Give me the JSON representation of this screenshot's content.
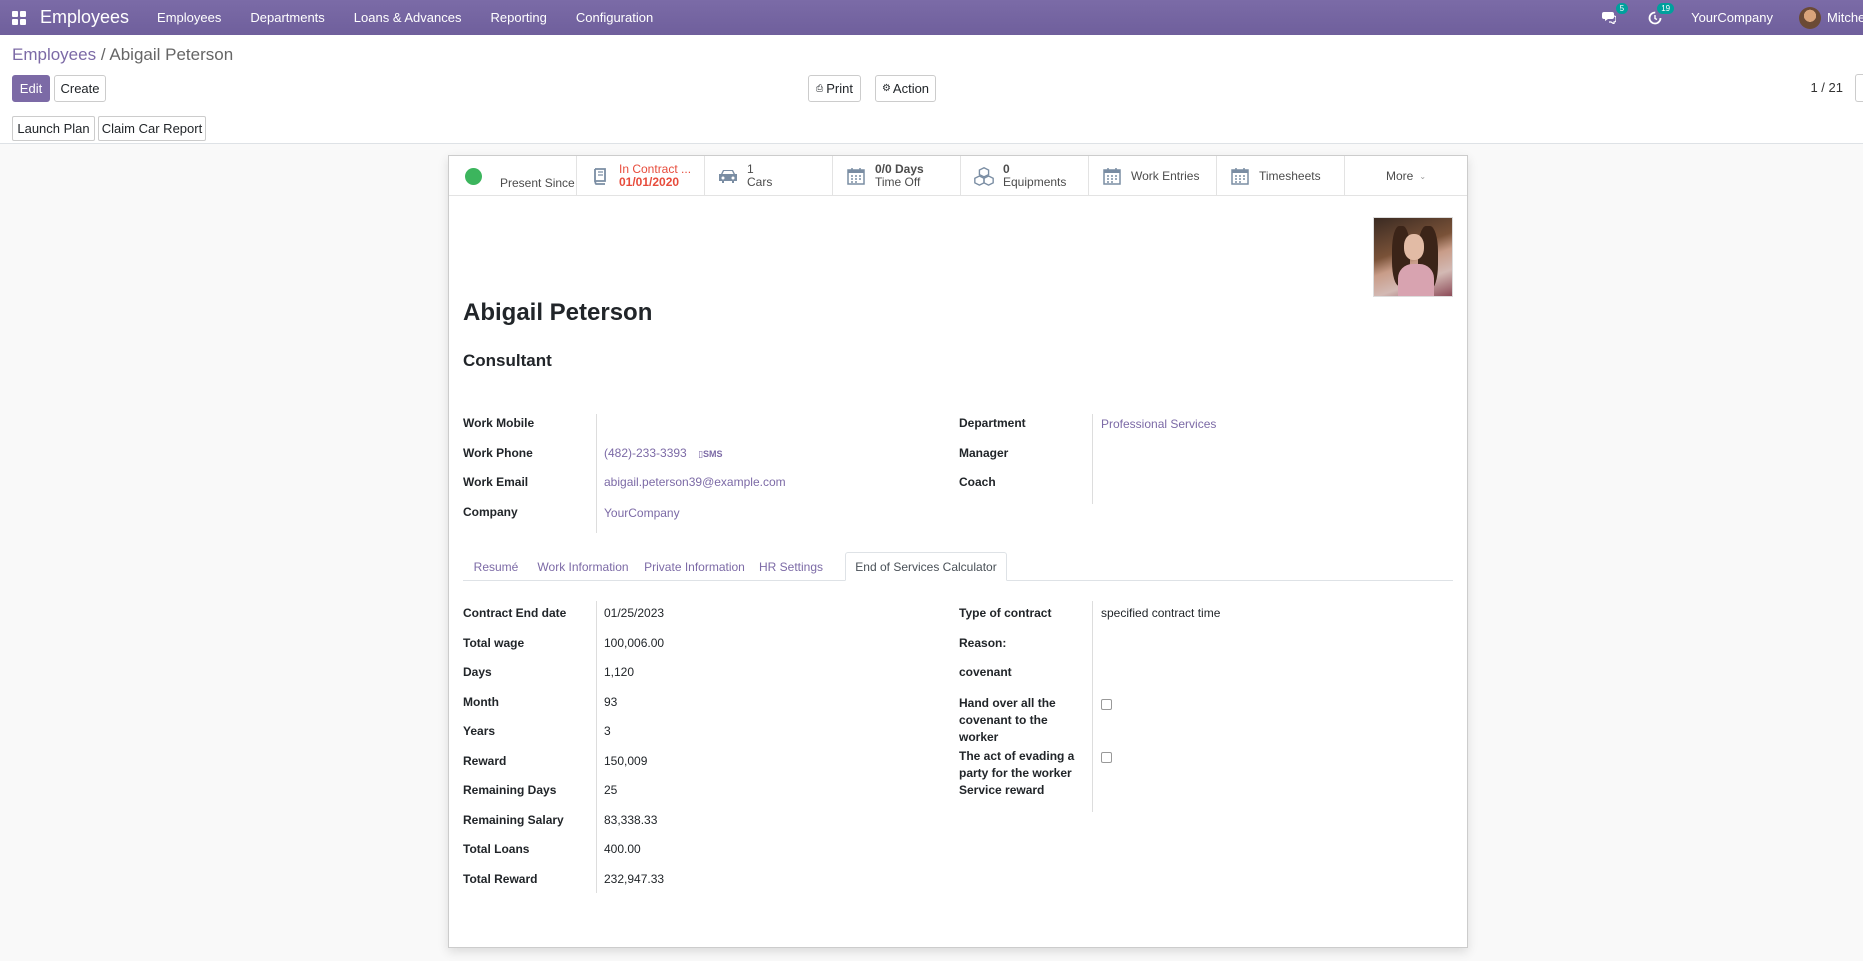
{
  "navbar": {
    "app_title": "Employees",
    "menu": [
      "Employees",
      "Departments",
      "Loans & Advances",
      "Reporting",
      "Configuration"
    ],
    "messages_count": "5",
    "activities_count": "19",
    "company": "YourCompany",
    "user": "Mitchell Admin"
  },
  "control_panel": {
    "breadcrumb_parent": "Employees",
    "breadcrumb_separator": "/",
    "breadcrumb_current": "Abigail Peterson",
    "edit_label": "Edit",
    "create_label": "Create",
    "print_label": "Print",
    "action_label": "Action",
    "pager": "1 / 21",
    "launch_plan_label": "Launch Plan",
    "claim_car_report_label": "Claim Car Report"
  },
  "smart_buttons": {
    "presence_label": "Present Since",
    "contract_value": "In Contract ...",
    "contract_label": "01/01/2020",
    "cars_value": "1",
    "cars_label": "Cars",
    "timeoff_value": "0/0 Days",
    "timeoff_label": "Time Off",
    "equipments_value": "0",
    "equipments_label": "Equipments",
    "work_entries_label": "Work Entries",
    "timesheets_label": "Timesheets",
    "more_label": "More"
  },
  "employee": {
    "name": "Abigail Peterson",
    "job_title": "Consultant"
  },
  "info_left": {
    "work_mobile_label": "Work Mobile",
    "work_mobile": "",
    "work_phone_label": "Work Phone",
    "work_phone": "(482)-233-3393",
    "sms_label": "SMS",
    "work_email_label": "Work Email",
    "work_email": "abigail.peterson39@example.com",
    "company_label": "Company",
    "company": "YourCompany"
  },
  "info_right": {
    "department_label": "Department",
    "department": "Professional Services",
    "manager_label": "Manager",
    "manager": "",
    "coach_label": "Coach",
    "coach": ""
  },
  "tabs": [
    "Resumé",
    "Work Information",
    "Private Information",
    "HR Settings",
    "End of Services Calculator"
  ],
  "active_tab": "End of Services Calculator",
  "eos_left": {
    "contract_end_label": "Contract End date",
    "contract_end": "01/25/2023",
    "total_wage_label": "Total wage",
    "total_wage": "100,006.00",
    "days_label": "Days",
    "days": "1,120",
    "month_label": "Month",
    "month": "93",
    "years_label": "Years",
    "years": "3",
    "reward_label": "Reward",
    "reward": "150,009",
    "remaining_days_label": "Remaining Days",
    "remaining_days": "25",
    "remaining_salary_label": "Remaining Salary",
    "remaining_salary": "83,338.33",
    "total_loans_label": "Total Loans",
    "total_loans": "400.00",
    "total_reward_label": "Total Reward",
    "total_reward": "232,947.33"
  },
  "eos_right": {
    "type_of_contract_label": "Type of contract",
    "type_of_contract": "specified contract time",
    "reason_label": "Reason:",
    "covenant_label": "covenant",
    "hand_over_label_1": "Hand over all the",
    "hand_over_label_2": "covenant to the",
    "hand_over_label_3": "worker",
    "hand_over_checked": false,
    "evading_label_1": "The act of evading a",
    "evading_label_2": "party for the worker",
    "evading_label_3": "Service reward",
    "evading_checked": false
  }
}
